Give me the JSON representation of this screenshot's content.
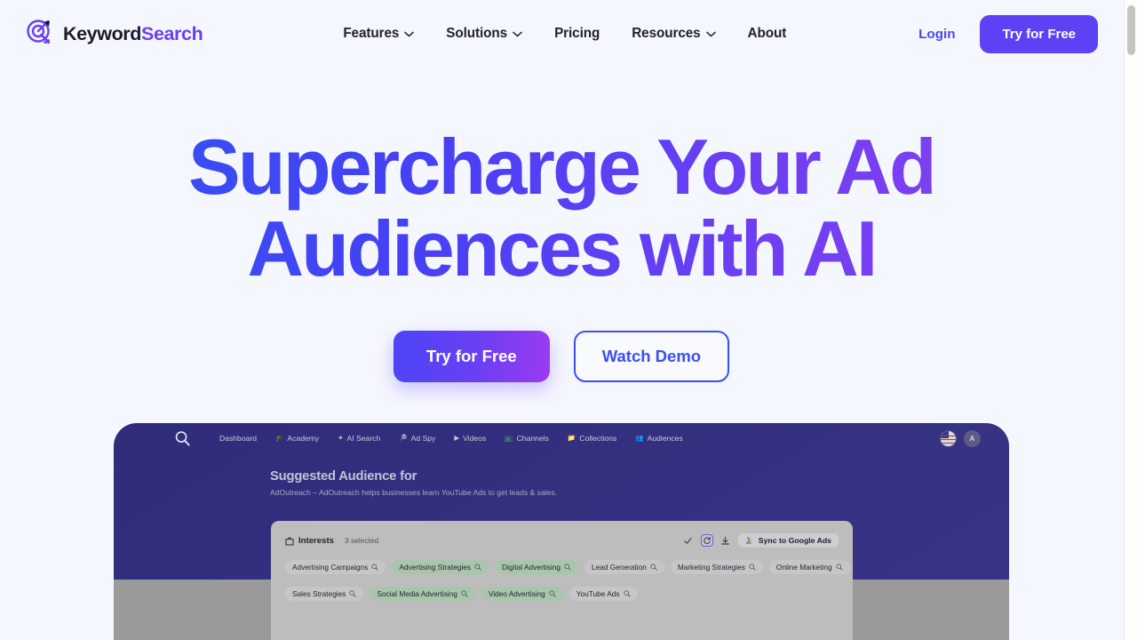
{
  "brand": {
    "name_part1": "Keyword",
    "name_part2": "Search",
    "logo_icon": "target-key-icon"
  },
  "nav": {
    "items": [
      {
        "label": "Features",
        "has_dropdown": true
      },
      {
        "label": "Solutions",
        "has_dropdown": true
      },
      {
        "label": "Pricing",
        "has_dropdown": false
      },
      {
        "label": "Resources",
        "has_dropdown": true
      },
      {
        "label": "About",
        "has_dropdown": false
      }
    ],
    "login_label": "Login",
    "cta_label": "Try for Free"
  },
  "hero": {
    "heading_line1": "Supercharge Your Ad",
    "heading_line2": "Audiences with AI",
    "primary_cta": "Try for Free",
    "secondary_cta": "Watch Demo",
    "gradient_start": "#2e56f2",
    "gradient_end": "#9040ef"
  },
  "app": {
    "nav_items": [
      {
        "label": "Dashboard",
        "icon": ""
      },
      {
        "label": "Academy",
        "icon": "🎓"
      },
      {
        "label": "AI Search",
        "icon": "✦"
      },
      {
        "label": "Ad Spy",
        "icon": "🔎"
      },
      {
        "label": "Videos",
        "icon": "▶"
      },
      {
        "label": "Channels",
        "icon": "📺"
      },
      {
        "label": "Collections",
        "icon": "📁"
      },
      {
        "label": "Audiences",
        "icon": "👥"
      }
    ],
    "avatar_initial": "A",
    "title": "Suggested Audience for",
    "subtitle": "AdOutreach – AdOutreach helps businesses learn YouTube Ads to get leads & sales.",
    "panel": {
      "label": "Interests",
      "count": "3 selected",
      "sync_label": "Sync to Google Ads",
      "tools": [
        "check-icon",
        "refresh-icon",
        "download-icon"
      ],
      "tags_row1": [
        {
          "label": "Advertising Campaigns",
          "selected": false
        },
        {
          "label": "Advertising Strategies",
          "selected": true
        },
        {
          "label": "Digital Advertising",
          "selected": true
        },
        {
          "label": "Lead Generation",
          "selected": false
        },
        {
          "label": "Marketing Strategies",
          "selected": false
        },
        {
          "label": "Online Marketing",
          "selected": false
        }
      ],
      "tags_row2": [
        {
          "label": "Sales Strategies",
          "selected": false
        },
        {
          "label": "Social Media Advertising",
          "selected": true
        },
        {
          "label": "Video Advertising",
          "selected": true
        },
        {
          "label": "YouTube Ads",
          "selected": false
        }
      ]
    }
  }
}
